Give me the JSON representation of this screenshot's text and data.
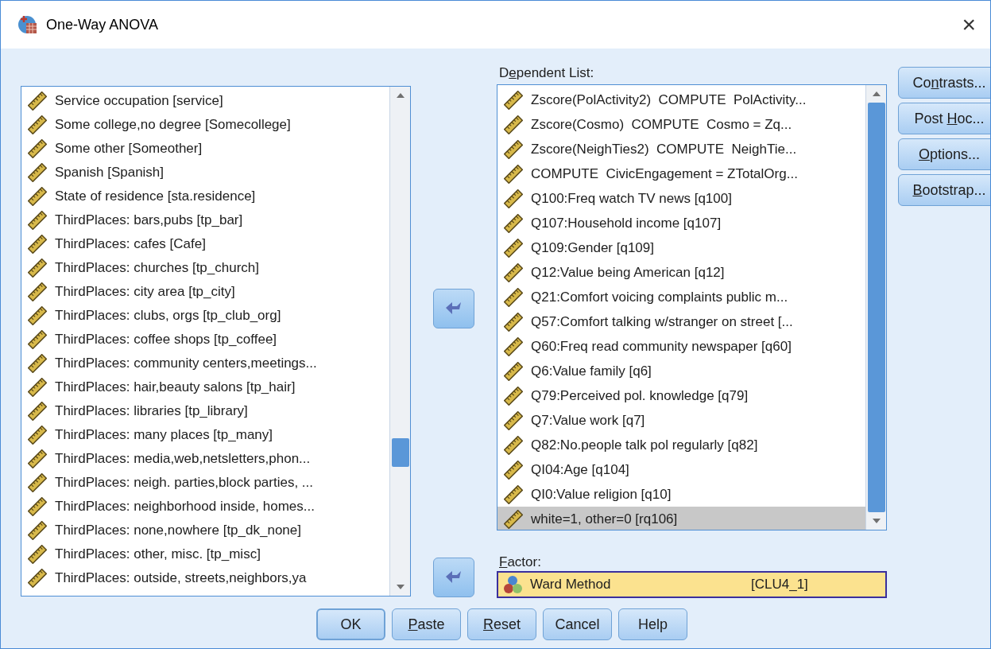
{
  "window": {
    "title": "One-Way ANOVA",
    "close": "×"
  },
  "source_list": {
    "items": [
      {
        "label": "Service occupation [service]",
        "selected": false
      },
      {
        "label": "Some college,no degree [Somecollege]",
        "selected": false
      },
      {
        "label": "Some other [Someother]",
        "selected": false
      },
      {
        "label": "Spanish [Spanish]",
        "selected": false
      },
      {
        "label": "State of residence [sta.residence]",
        "selected": false
      },
      {
        "label": "ThirdPlaces: bars,pubs [tp_bar]",
        "selected": false
      },
      {
        "label": "ThirdPlaces: cafes [Cafe]",
        "selected": false
      },
      {
        "label": "ThirdPlaces: churches [tp_church]",
        "selected": false
      },
      {
        "label": "ThirdPlaces: city area [tp_city]",
        "selected": false
      },
      {
        "label": "ThirdPlaces: clubs, orgs [tp_club_org]",
        "selected": false
      },
      {
        "label": "ThirdPlaces: coffee shops [tp_coffee]",
        "selected": false
      },
      {
        "label": "ThirdPlaces: community centers,meetings...",
        "selected": false
      },
      {
        "label": "ThirdPlaces: hair,beauty salons [tp_hair]",
        "selected": false
      },
      {
        "label": "ThirdPlaces: libraries [tp_library]",
        "selected": false
      },
      {
        "label": "ThirdPlaces: many places [tp_many]",
        "selected": false
      },
      {
        "label": "ThirdPlaces: media,web,netsletters,phon...",
        "selected": false
      },
      {
        "label": "ThirdPlaces: neigh. parties,block parties, ...",
        "selected": false
      },
      {
        "label": "ThirdPlaces: neighborhood inside, homes...",
        "selected": false
      },
      {
        "label": "ThirdPlaces: none,nowhere [tp_dk_none]",
        "selected": false
      },
      {
        "label": "ThirdPlaces: other, misc. [tp_misc]",
        "selected": false
      },
      {
        "label": "ThirdPlaces: outside, streets,neighbors,ya",
        "selected": false
      }
    ]
  },
  "dependent_list": {
    "label": [
      {
        "text": "D",
        "underlined": false
      },
      {
        "text": "e",
        "underlined": true
      },
      {
        "text": "pendent List:",
        "underlined": false
      }
    ],
    "items": [
      {
        "label": "Zscore(PolActivity2)  COMPUTE  PolActivity...",
        "selected": false
      },
      {
        "label": "Zscore(Cosmo)  COMPUTE  Cosmo = Zq...",
        "selected": false
      },
      {
        "label": "Zscore(NeighTies2)  COMPUTE  NeighTie...",
        "selected": false
      },
      {
        "label": "COMPUTE  CivicEngagement = ZTotalOrg...",
        "selected": false
      },
      {
        "label": "Q100:Freq watch TV news [q100]",
        "selected": false
      },
      {
        "label": "Q107:Household income [q107]",
        "selected": false
      },
      {
        "label": "Q109:Gender [q109]",
        "selected": false
      },
      {
        "label": "Q12:Value being American [q12]",
        "selected": false
      },
      {
        "label": "Q21:Comfort voicing complaints public m...",
        "selected": false
      },
      {
        "label": "Q57:Comfort talking w/stranger on street [...",
        "selected": false
      },
      {
        "label": "Q60:Freq read community newspaper [q60]",
        "selected": false
      },
      {
        "label": "Q6:Value family [q6]",
        "selected": false
      },
      {
        "label": "Q79:Perceived pol. knowledge [q79]",
        "selected": false
      },
      {
        "label": "Q7:Value work [q7]",
        "selected": false
      },
      {
        "label": "Q82:No.people talk pol regularly [q82]",
        "selected": false
      },
      {
        "label": "QI04:Age [q104]",
        "selected": false
      },
      {
        "label": "QI0:Value religion [q10]",
        "selected": false
      },
      {
        "label": "white=1, other=0 [rq106]",
        "selected": true
      }
    ]
  },
  "factor": {
    "label": [
      {
        "text": "F",
        "underlined": true
      },
      {
        "text": "actor:",
        "underlined": false
      }
    ],
    "name": "Ward Method",
    "variable": "[CLU4_1]",
    "selected": true
  },
  "side_buttons": [
    {
      "label": [
        {
          "text": "Co",
          "underlined": false
        },
        {
          "text": "n",
          "underlined": true
        },
        {
          "text": "trasts...",
          "underlined": false
        }
      ]
    },
    {
      "label": [
        {
          "text": "Post ",
          "underlined": false
        },
        {
          "text": "H",
          "underlined": true
        },
        {
          "text": "oc...",
          "underlined": false
        }
      ]
    },
    {
      "label": [
        {
          "text": "O",
          "underlined": true
        },
        {
          "text": "ptions...",
          "underlined": false
        }
      ]
    },
    {
      "label": [
        {
          "text": "B",
          "underlined": true
        },
        {
          "text": "ootstrap...",
          "underlined": false
        }
      ]
    }
  ],
  "bottom_buttons": [
    {
      "label": [
        {
          "text": "OK",
          "underlined": false
        }
      ],
      "default": true
    },
    {
      "label": [
        {
          "text": "P",
          "underlined": true
        },
        {
          "text": "aste",
          "underlined": false
        }
      ],
      "default": false
    },
    {
      "label": [
        {
          "text": "R",
          "underlined": true
        },
        {
          "text": "eset",
          "underlined": false
        }
      ],
      "default": false
    },
    {
      "label": [
        {
          "text": "Cancel",
          "underlined": false
        }
      ],
      "default": false
    },
    {
      "label": [
        {
          "text": "Help",
          "underlined": false
        }
      ],
      "default": false
    }
  ]
}
